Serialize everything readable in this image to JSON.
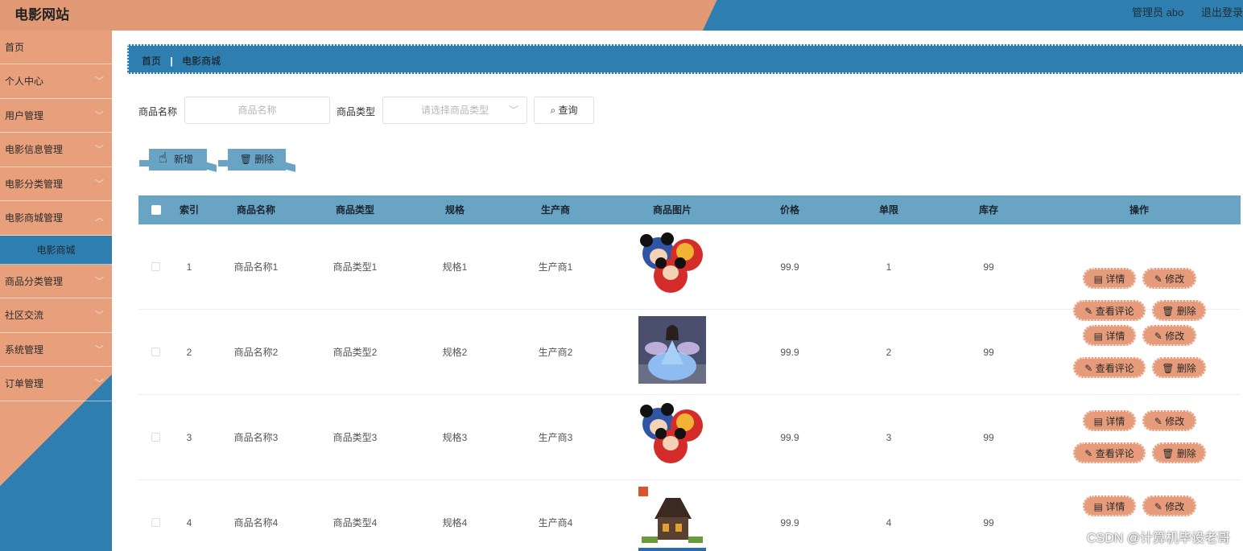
{
  "header": {
    "site_title": "电影网站",
    "admin_label": "管理员 abo",
    "logout_label": "退出登录"
  },
  "sidebar": {
    "items": [
      {
        "label": "首页",
        "has_chevron": false
      },
      {
        "label": "个人中心",
        "has_chevron": true
      },
      {
        "label": "用户管理",
        "has_chevron": true
      },
      {
        "label": "电影信息管理",
        "has_chevron": true
      },
      {
        "label": "电影分类管理",
        "has_chevron": true
      },
      {
        "label": "电影商城管理",
        "has_chevron": true
      },
      {
        "label": "电影商城",
        "sub": true
      },
      {
        "label": "商品分类管理",
        "has_chevron": true
      },
      {
        "label": "社区交流",
        "has_chevron": true
      },
      {
        "label": "系统管理",
        "has_chevron": true
      },
      {
        "label": "订单管理",
        "has_chevron": true
      }
    ]
  },
  "breadcrumb": {
    "home": "首页",
    "separator": "|",
    "current": "电影商城"
  },
  "search": {
    "name_label": "商品名称",
    "name_placeholder": "商品名称",
    "type_label": "商品类型",
    "type_placeholder": "请选择商品类型",
    "query_label": "查询"
  },
  "actions": {
    "add_label": "新增",
    "delete_label": "删除"
  },
  "table": {
    "headers": [
      "索引",
      "商品名称",
      "商品类型",
      "规格",
      "生产商",
      "商品图片",
      "价格",
      "单限",
      "库存",
      "操作"
    ],
    "rows": [
      {
        "index": "1",
        "name": "商品名称1",
        "type": "商品类型1",
        "spec": "规格1",
        "maker": "生产商1",
        "image": "mickey-plush-backpacks",
        "price": "99.9",
        "limit": "1",
        "stock": "99"
      },
      {
        "index": "2",
        "name": "商品名称2",
        "type": "商品类型2",
        "spec": "规格2",
        "maker": "生产商2",
        "image": "princess-doll",
        "price": "99.9",
        "limit": "2",
        "stock": "99"
      },
      {
        "index": "3",
        "name": "商品名称3",
        "type": "商品类型3",
        "spec": "规格3",
        "maker": "生产商3",
        "image": "mickey-plush-backpacks",
        "price": "99.9",
        "limit": "3",
        "stock": "99"
      },
      {
        "index": "4",
        "name": "商品名称4",
        "type": "商品类型4",
        "spec": "规格4",
        "maker": "生产商4",
        "image": "block-castle-set",
        "price": "99.9",
        "limit": "4",
        "stock": "99"
      }
    ],
    "op_labels": {
      "detail": "详情",
      "edit": "修改",
      "comments": "查看评论",
      "delete": "删除"
    }
  },
  "watermark": "CSDN @计算机毕设老哥",
  "colors": {
    "orange": "#e29a76",
    "blue": "#2e7fb0",
    "table_header": "#6aa4c4"
  }
}
